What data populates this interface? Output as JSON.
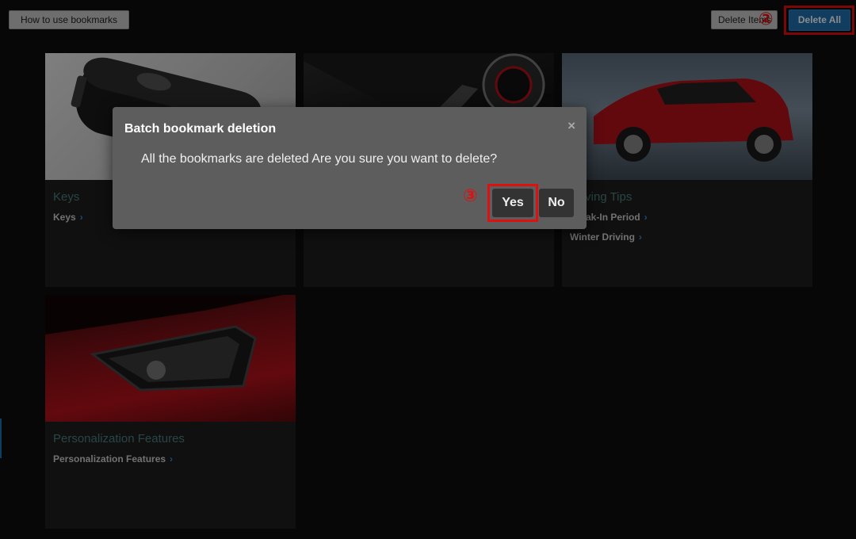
{
  "toolbar": {
    "help_label": "How to use bookmarks",
    "delete_items_label": "Delete Items",
    "delete_all_label": "Delete All"
  },
  "annotations": {
    "step2": "②",
    "step3": "③"
  },
  "cards": [
    {
      "title": "Keys",
      "links": [
        "Keys"
      ]
    },
    {
      "title": "",
      "links": []
    },
    {
      "title": "Driving Tips",
      "links": [
        "Break-In Period",
        "Winter Driving"
      ]
    },
    {
      "title": "Personalization Features",
      "links": [
        "Personalization Features"
      ]
    }
  ],
  "dialog": {
    "title": "Batch bookmark deletion",
    "close": "×",
    "message": "All the bookmarks are deleted Are you sure you want to delete?",
    "yes_label": "Yes",
    "no_label": "No"
  },
  "colors": {
    "accent_blue": "#1f6fb0",
    "highlight_red": "#e01010",
    "car_red": "#b3121a"
  }
}
